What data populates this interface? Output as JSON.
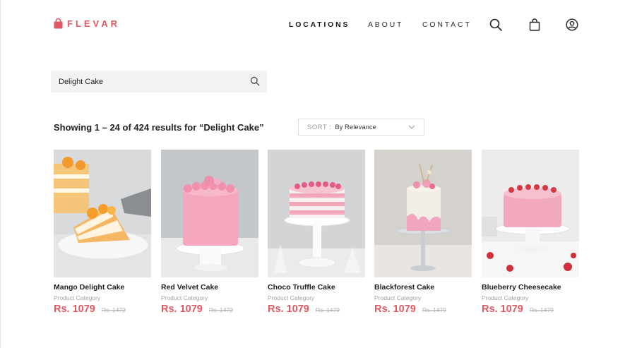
{
  "brand": {
    "name": "FLEVAR",
    "color": "#e05a63"
  },
  "nav": {
    "locations": "LOCATIONS",
    "about": "ABOUT",
    "contact": "CONTACT"
  },
  "header_icons": [
    "search-icon",
    "shopping-bag-icon",
    "user-account-icon"
  ],
  "search": {
    "value": "Delight Cake"
  },
  "results": {
    "summary": "Showing 1 – 24 of 424 results for “Delight Cake”"
  },
  "sort": {
    "label": "SORT :",
    "value": "By Relevance"
  },
  "products": [
    {
      "name": "Mango Delight Cake",
      "category": "Product Category",
      "price": "Rs. 1079",
      "old_price": "Rs. 1479"
    },
    {
      "name": "Red Velvet Cake",
      "category": "Product Category",
      "price": "Rs. 1079",
      "old_price": "Rs. 1479"
    },
    {
      "name": "Choco Truffle Cake",
      "category": "Product Category",
      "price": "Rs. 1079",
      "old_price": "Rs. 1479"
    },
    {
      "name": "Blackforest Cake",
      "category": "Product Category",
      "price": "Rs. 1079",
      "old_price": "Rs. 1479"
    },
    {
      "name": "Blueberry Cheesecake",
      "category": "Product Category",
      "price": "Rs. 1079",
      "old_price": "Rs. 1479"
    }
  ]
}
